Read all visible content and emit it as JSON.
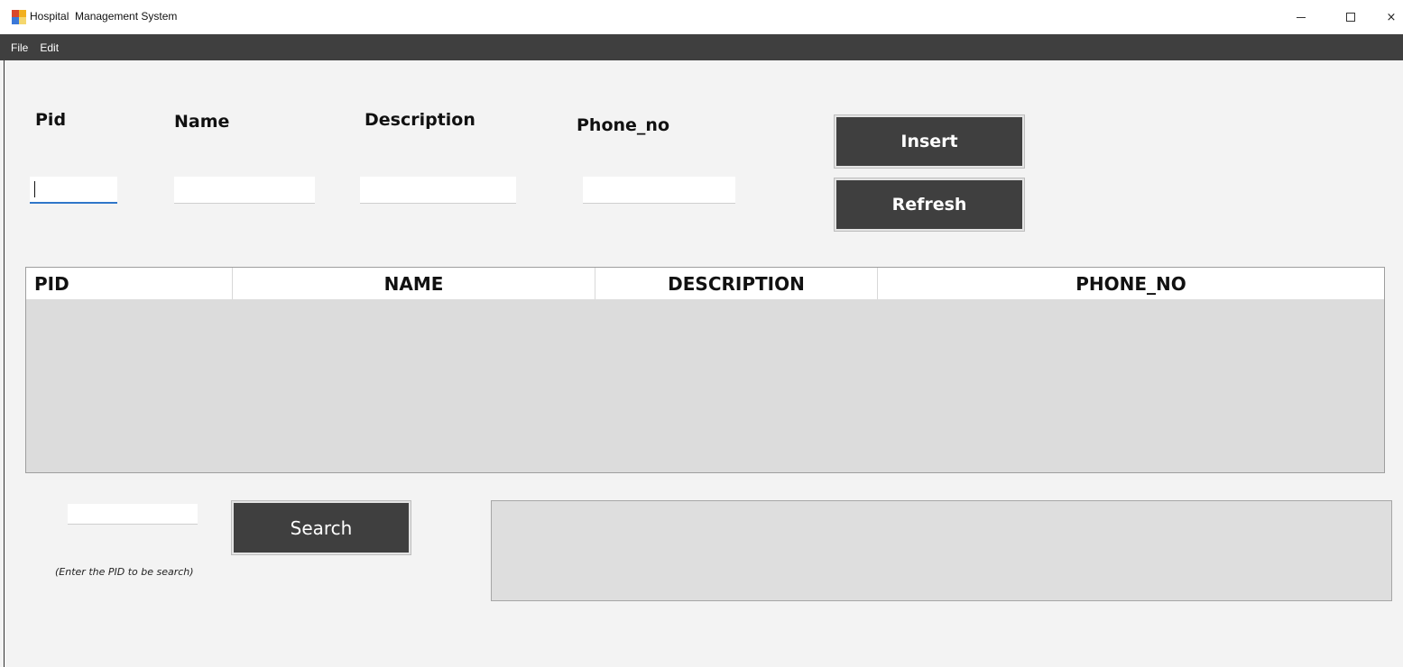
{
  "window": {
    "title": "Hospital  Management System",
    "controls": {
      "minimize": "minimize-icon",
      "maximize": "maximize-icon",
      "close": "×"
    }
  },
  "menu": {
    "items": [
      "File",
      "Edit"
    ]
  },
  "form": {
    "labels": {
      "pid": "Pid",
      "name": "Name",
      "description": "Description",
      "phone": "Phone_no"
    },
    "values": {
      "pid": "",
      "name": "",
      "description": "",
      "phone": ""
    }
  },
  "buttons": {
    "insert": "Insert",
    "refresh": "Refresh",
    "search": "Search"
  },
  "grid": {
    "columns": [
      "PID",
      "NAME",
      "DESCRIPTION",
      "PHONE_NO"
    ],
    "rows": []
  },
  "search": {
    "value": "",
    "hint": "(Enter the PID to be search)"
  },
  "colors": {
    "accent": "#2f76c9",
    "dark": "#3f3f3f",
    "panel": "#dcdcdc"
  }
}
